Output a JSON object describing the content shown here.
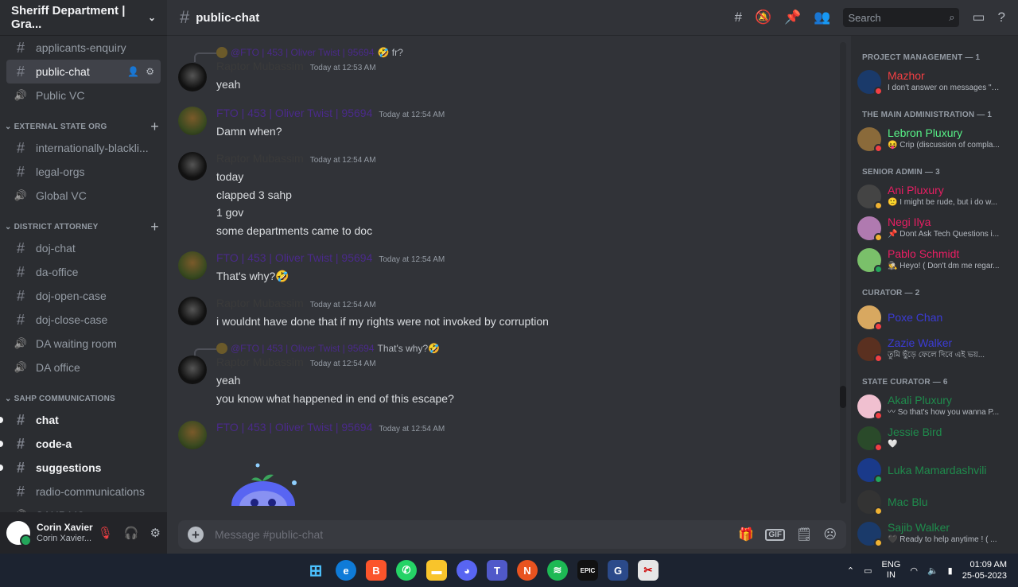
{
  "server": {
    "name": "Sheriff Department | Gra...",
    "chevron_icon": "chevron-down-icon"
  },
  "channels_top": [
    {
      "type": "text",
      "label": "applicants-enquiry"
    },
    {
      "type": "text",
      "label": "public-chat",
      "active": true
    },
    {
      "type": "voice",
      "label": "Public VC"
    }
  ],
  "categories": [
    {
      "label": "EXTERNAL STATE ORG",
      "channels": [
        {
          "type": "text",
          "label": "internationally-blackli..."
        },
        {
          "type": "text",
          "label": "legal-orgs"
        },
        {
          "type": "voice",
          "label": "Global VC"
        }
      ]
    },
    {
      "label": "DISTRICT ATTORNEY",
      "channels": [
        {
          "type": "text",
          "label": "doj-chat"
        },
        {
          "type": "text",
          "label": "da-office"
        },
        {
          "type": "text",
          "label": "doj-open-case"
        },
        {
          "type": "text",
          "label": "doj-close-case"
        },
        {
          "type": "voice",
          "label": "DA waiting room"
        },
        {
          "type": "voice",
          "label": "DA office"
        }
      ]
    },
    {
      "label": "SAHP COMMUNICATIONS",
      "channels": [
        {
          "type": "text",
          "label": "chat",
          "unread": true
        },
        {
          "type": "text",
          "label": "code-a",
          "unread": true
        },
        {
          "type": "text",
          "label": "suggestions",
          "unread": true
        },
        {
          "type": "text",
          "label": "radio-communications"
        },
        {
          "type": "voice",
          "label": "SAHP VC"
        }
      ]
    }
  ],
  "user": {
    "name": "Corin Xavier",
    "sub": "Corin Xavier..."
  },
  "topbar": {
    "channel": "public-chat",
    "search_placeholder": "Search"
  },
  "messages": {
    "m1": {
      "reply_name": "@FTO | 453 | Oliver Twist | 95694",
      "reply_text": "🤣 fr?",
      "author": "Raptor Mubassim",
      "time": "Today at 12:53 AM",
      "lines": [
        "yeah"
      ]
    },
    "m2": {
      "author": "FTO | 453 | Oliver Twist | 95694",
      "time": "Today at 12:54 AM",
      "lines": [
        "Damn when?"
      ]
    },
    "m3": {
      "author": "Raptor Mubassim",
      "time": "Today at 12:54 AM",
      "lines": [
        "today",
        "clapped 3 sahp",
        "1 gov",
        "some departments came to doc"
      ]
    },
    "m4": {
      "author": "FTO | 453 | Oliver Twist | 95694",
      "time": "Today at 12:54 AM",
      "lines": [
        "That's why?🤣"
      ]
    },
    "m5": {
      "author": "Raptor Mubassim",
      "time": "Today at 12:54 AM",
      "lines": [
        "i wouldnt have done that if my rights were not invoked by corruption"
      ]
    },
    "m6": {
      "reply_name": "@FTO | 453 | Oliver Twist | 95694",
      "reply_text": "That's why?🤣",
      "author": "Raptor Mubassim",
      "time": "Today at 12:54 AM",
      "lines": [
        "yeah",
        "you know what happened in end of this escape?"
      ]
    },
    "m7": {
      "author": "FTO | 453 | Oliver Twist | 95694",
      "time": "Today at 12:54 AM",
      "lines": []
    }
  },
  "composer": {
    "placeholder": "Message #public-chat",
    "gif_label": "GIF"
  },
  "member_groups": [
    {
      "label": "PROJECT MANAGEMENT — 1",
      "members": [
        {
          "name": "Mazhor",
          "status": "I don't answer on messages \"H...",
          "color": "#f23f43",
          "presence": "dnd"
        }
      ]
    },
    {
      "label": "THE MAIN ADMINISTRATION — 1",
      "members": [
        {
          "name": "Lebron Pluxury",
          "status": "😝 Crip (discussion of compla...",
          "color": "#57f287",
          "presence": "dnd"
        }
      ]
    },
    {
      "label": "SENIOR ADMIN — 3",
      "members": [
        {
          "name": "Ani Pluxury",
          "status": "🙁 I might be rude, but i do w...",
          "color": "#e91e63",
          "presence": "idle"
        },
        {
          "name": "Negi Ilya",
          "status": "📌 Dont Ask Tech Questions i...",
          "color": "#e91e63",
          "presence": "idle"
        },
        {
          "name": "Pablo Schmidt",
          "status": "🕵 Heyo! ( Don't dm me regar...",
          "color": "#e91e63",
          "presence": "on"
        }
      ]
    },
    {
      "label": "CURATOR — 2",
      "members": [
        {
          "name": "Poxe Chan",
          "status": "",
          "color": "#3b3bd6",
          "presence": "dnd"
        },
        {
          "name": "Zazie Walker",
          "status": "তুমি ছুঁড়ে ফেলে দিবে এই ভয়...",
          "color": "#3b3bd6",
          "presence": "dnd"
        }
      ]
    },
    {
      "label": "STATE CURATOR — 6",
      "members": [
        {
          "name": "Akali Pluxury",
          "status": "〰 So that's how you wanna P...",
          "color": "#1f8b4c",
          "presence": "dnd"
        },
        {
          "name": "Jessie Bird",
          "status": "🤍",
          "color": "#1f8b4c",
          "presence": "dnd"
        },
        {
          "name": "Luka Mamardashvili",
          "status": "",
          "color": "#1f8b4c",
          "presence": "on"
        },
        {
          "name": "Mac Blu",
          "status": "",
          "color": "#1f8b4c",
          "presence": "idle"
        },
        {
          "name": "Sajib Walker",
          "status": "🖤 Ready to help anytime ! ( ...",
          "color": "#1f8b4c",
          "presence": "idle"
        }
      ]
    }
  ],
  "taskbar": {
    "lang1": "ENG",
    "lang2": "IN",
    "time": "01:09 AM",
    "date": "25-05-2023"
  }
}
